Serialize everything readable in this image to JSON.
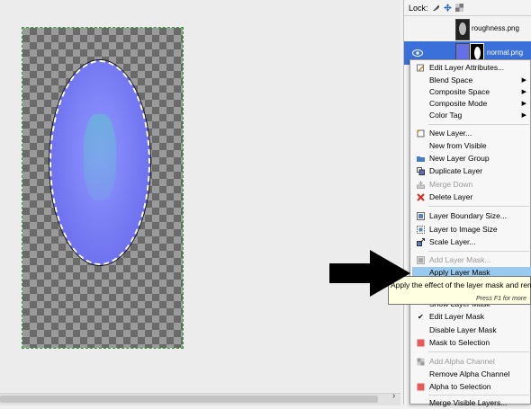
{
  "canvas": {
    "image_description_layer": "normal.png"
  },
  "panel": {
    "lock_label": "Lock:",
    "layers": [
      {
        "name": "roughness.png"
      },
      {
        "name": "normal.png"
      }
    ]
  },
  "menu": {
    "items": [
      {
        "label": "Edit Layer Attributes...",
        "icon": "edit-attributes-icon"
      },
      {
        "label": "Blend Space",
        "submenu": "▶"
      },
      {
        "label": "Composite Space",
        "submenu": "▶"
      },
      {
        "label": "Composite Mode",
        "submenu": "▶"
      },
      {
        "label": "Color Tag",
        "submenu": "▶"
      },
      {
        "label": "New Layer...",
        "icon": "new-layer-icon"
      },
      {
        "label": "New from Visible"
      },
      {
        "label": "New Layer Group",
        "icon": "layer-group-icon"
      },
      {
        "label": "Duplicate Layer",
        "icon": "duplicate-layer-icon"
      },
      {
        "label": "Merge Down",
        "icon": "merge-down-icon"
      },
      {
        "label": "Delete Layer",
        "icon": "delete-icon"
      },
      {
        "label": "Layer Boundary Size...",
        "icon": "boundary-size-icon"
      },
      {
        "label": "Layer to Image Size",
        "icon": "to-image-size-icon"
      },
      {
        "label": "Scale Layer...",
        "icon": "scale-layer-icon"
      },
      {
        "label": "Add Layer Mask...",
        "icon": "add-mask-icon"
      },
      {
        "label": "Apply Layer Mask"
      },
      {
        "label": "Show Layer Mask"
      },
      {
        "label": "Edit Layer Mask",
        "check": "✔"
      },
      {
        "label": "Disable Layer Mask"
      },
      {
        "label": "Mask to Selection",
        "icon": "mask-to-selection-icon"
      },
      {
        "label": "Add Alpha Channel",
        "icon": "add-alpha-icon"
      },
      {
        "label": "Remove Alpha Channel"
      },
      {
        "label": "Alpha to Selection",
        "icon": "alpha-to-selection-icon"
      },
      {
        "label": "Merge Visible Layers..."
      }
    ]
  },
  "tooltip": {
    "text": "Apply the effect of the layer mask and remo",
    "hint": "Press F1 for more"
  },
  "colors": {
    "highlight": "#99c9ef",
    "selected_layer": "#3b6fd9",
    "delete_red": "#d9281e"
  }
}
